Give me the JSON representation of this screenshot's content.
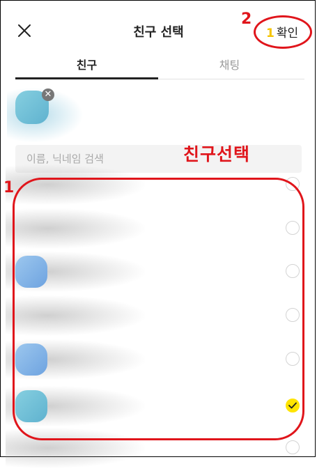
{
  "header": {
    "title": "친구 선택",
    "confirm_count": "1",
    "confirm_label": "확인"
  },
  "tabs": [
    {
      "label": "친구",
      "active": true
    },
    {
      "label": "채팅",
      "active": false
    }
  ],
  "search": {
    "placeholder": "이름, 닉네임 검색",
    "value": ""
  },
  "annotations": {
    "label_select": "친구선택",
    "step1": "1",
    "step2": "2",
    "color": "#e0151b"
  },
  "friends": [
    {
      "checked": false
    },
    {
      "checked": false
    },
    {
      "checked": false
    },
    {
      "checked": false
    },
    {
      "checked": false
    },
    {
      "checked": true
    },
    {
      "checked": false
    }
  ],
  "colors": {
    "accent": "#ffe400",
    "count": "#f5c400"
  }
}
